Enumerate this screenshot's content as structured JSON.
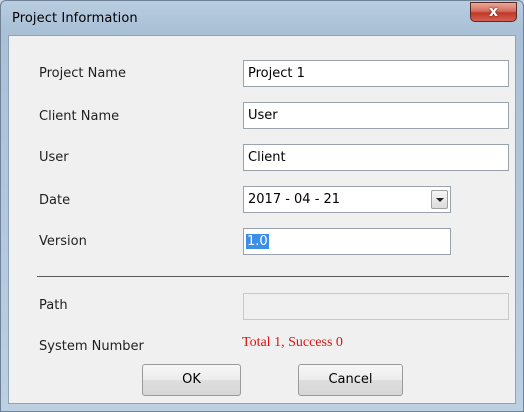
{
  "window": {
    "title": "Project Information",
    "close_glyph": "x"
  },
  "form": {
    "project_name": {
      "label": "Project Name",
      "value": "Project 1"
    },
    "client_name": {
      "label": "Client Name",
      "value": "User"
    },
    "user": {
      "label": "User",
      "value": "Client"
    },
    "date": {
      "label": "Date",
      "value": "2017 - 04 - 21"
    },
    "version": {
      "label": "Version",
      "value": "1.0"
    },
    "path": {
      "label": "Path",
      "value": ""
    },
    "system_number": {
      "label": "System Number",
      "value": "Total 1, Success 0"
    }
  },
  "buttons": {
    "ok": "OK",
    "cancel": "Cancel"
  },
  "colors": {
    "stats_text": "#e01010",
    "selection": "#3d8ee6",
    "close_button": "#c0392b"
  },
  "icons": {
    "close": "close-icon",
    "dropdown": "chevron-down-icon"
  }
}
